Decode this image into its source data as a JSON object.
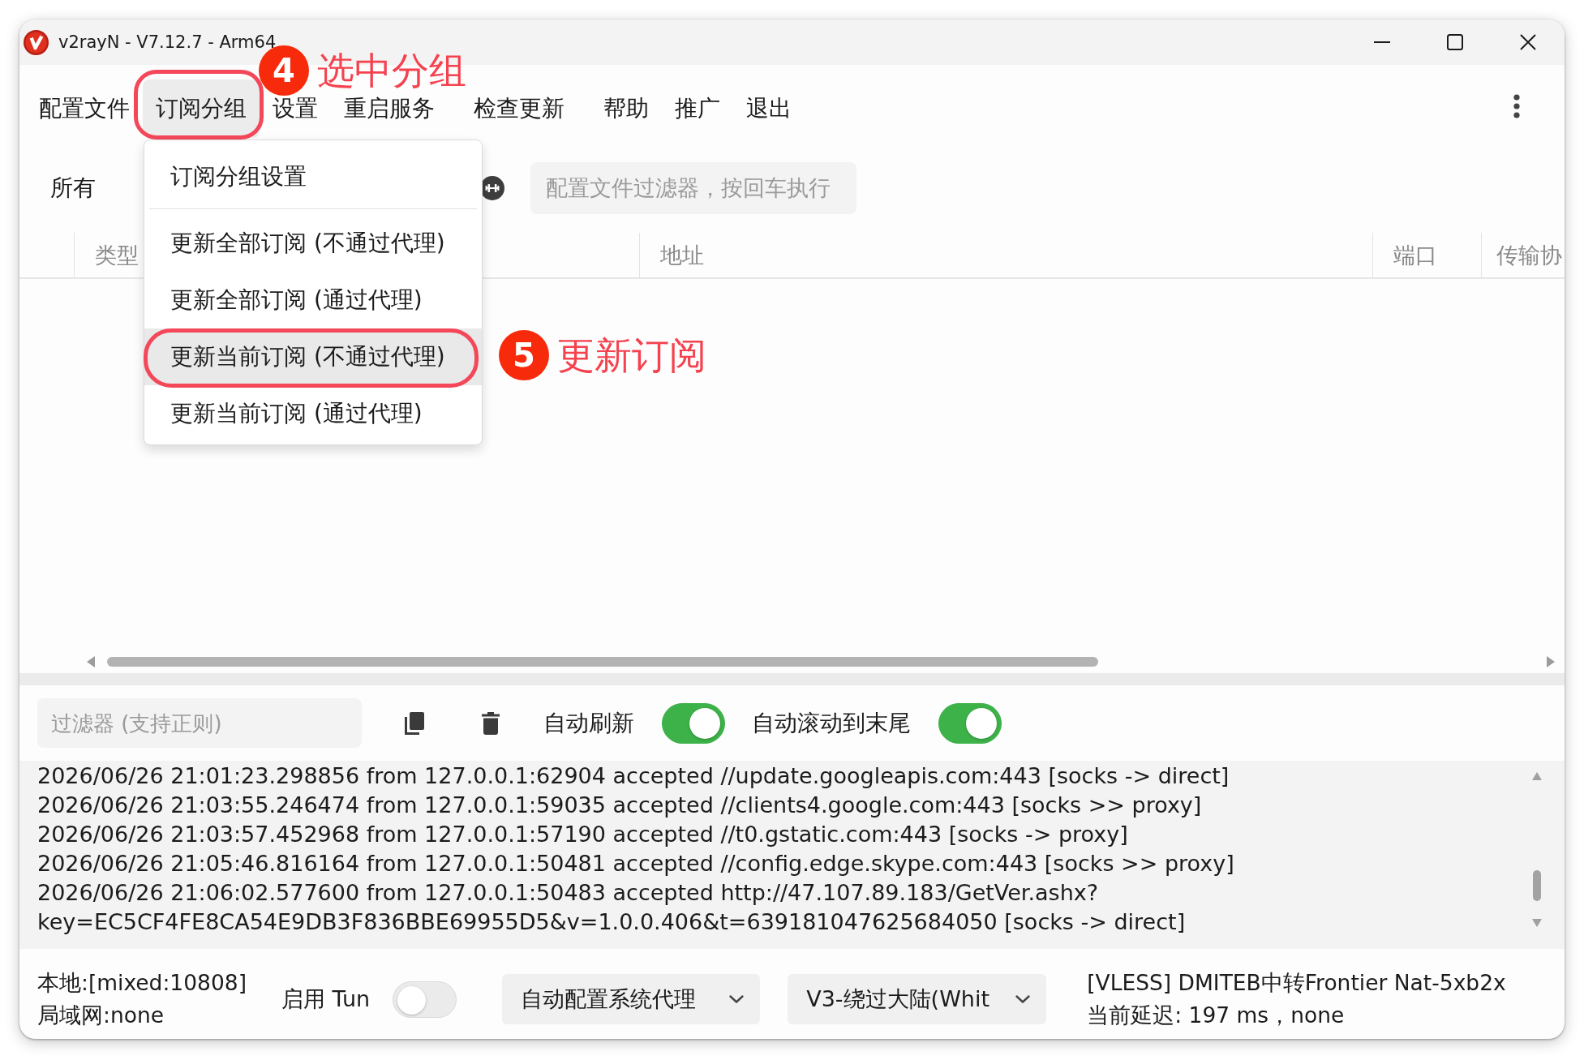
{
  "window": {
    "title": "v2rayN - V7.12.7 - Arm64"
  },
  "menu": [
    {
      "label": "配置文件",
      "selected": false
    },
    {
      "label": "订阅分组",
      "selected": true,
      "callout": {
        "number": "4",
        "text": "选中分组"
      },
      "submenu": [
        {
          "kind": "item",
          "label": "订阅分组设置",
          "selected": false
        },
        {
          "kind": "separator"
        },
        {
          "kind": "item",
          "label": "更新全部订阅 (不通过代理)",
          "selected": false
        },
        {
          "kind": "item",
          "label": "更新全部订阅 (通过代理)",
          "selected": false
        },
        {
          "kind": "item",
          "label": "更新当前订阅 (不通过代理)",
          "selected": true,
          "callout": {
            "number": "5",
            "text": "更新订阅"
          }
        },
        {
          "kind": "item",
          "label": "更新当前订阅 (通过代理)",
          "selected": false
        }
      ]
    },
    {
      "label": "设置",
      "selected": false
    },
    {
      "label": "重启服务",
      "selected": false
    },
    {
      "label": "检查更新",
      "selected": false
    },
    {
      "label": "帮助",
      "selected": false
    },
    {
      "label": "推广",
      "selected": false
    },
    {
      "label": "退出",
      "selected": false
    }
  ],
  "groups": [
    {
      "label": "所有"
    }
  ],
  "profile_filter": {
    "placeholder": "配置文件过滤器，按回车执行"
  },
  "table": {
    "columns": [
      "类型",
      "地址",
      "端口",
      "传输协"
    ]
  },
  "log": {
    "filter": {
      "placeholder": "过滤器 (支持正则)"
    },
    "switches": [
      {
        "label": "自动刷新",
        "on": true
      },
      {
        "label": "自动滚动到末尾",
        "on": true
      }
    ],
    "lines": [
      "2026/06/26 21:01:23.298856 from 127.0.0.1:62904 accepted //update.googleapis.com:443 [socks -> direct]",
      "2026/06/26 21:03:55.246474 from 127.0.0.1:59035 accepted //clients4.google.com:443 [socks >> proxy]",
      "2026/06/26 21:03:57.452968 from 127.0.0.1:57190 accepted //t0.gstatic.com:443 [socks -> proxy]",
      "2026/06/26 21:05:46.816164 from 127.0.0.1:50481 accepted //config.edge.skype.com:443 [socks >> proxy]",
      "2026/06/26 21:06:02.577600 from 127.0.0.1:50483 accepted http://47.107.89.183/GetVer.ashx?",
      "key=EC5CF4FE8CA54E9DB3F836BBE69955D5&v=1.0.0.406&t=639181047625684050 [socks -> direct]"
    ]
  },
  "status_bar": {
    "inbound": [
      "本地:[mixed:10808]",
      "局域网:none"
    ],
    "tun": {
      "label": "启用 Tun",
      "on": false
    },
    "dropdowns": [
      {
        "value": "自动配置系统代理"
      },
      {
        "value": "V3-绕过大陆(Whit"
      }
    ],
    "server": [
      "[VLESS] DMITEB中转Frontier Nat-5xb2x",
      "当前延迟: 197 ms，none"
    ]
  }
}
